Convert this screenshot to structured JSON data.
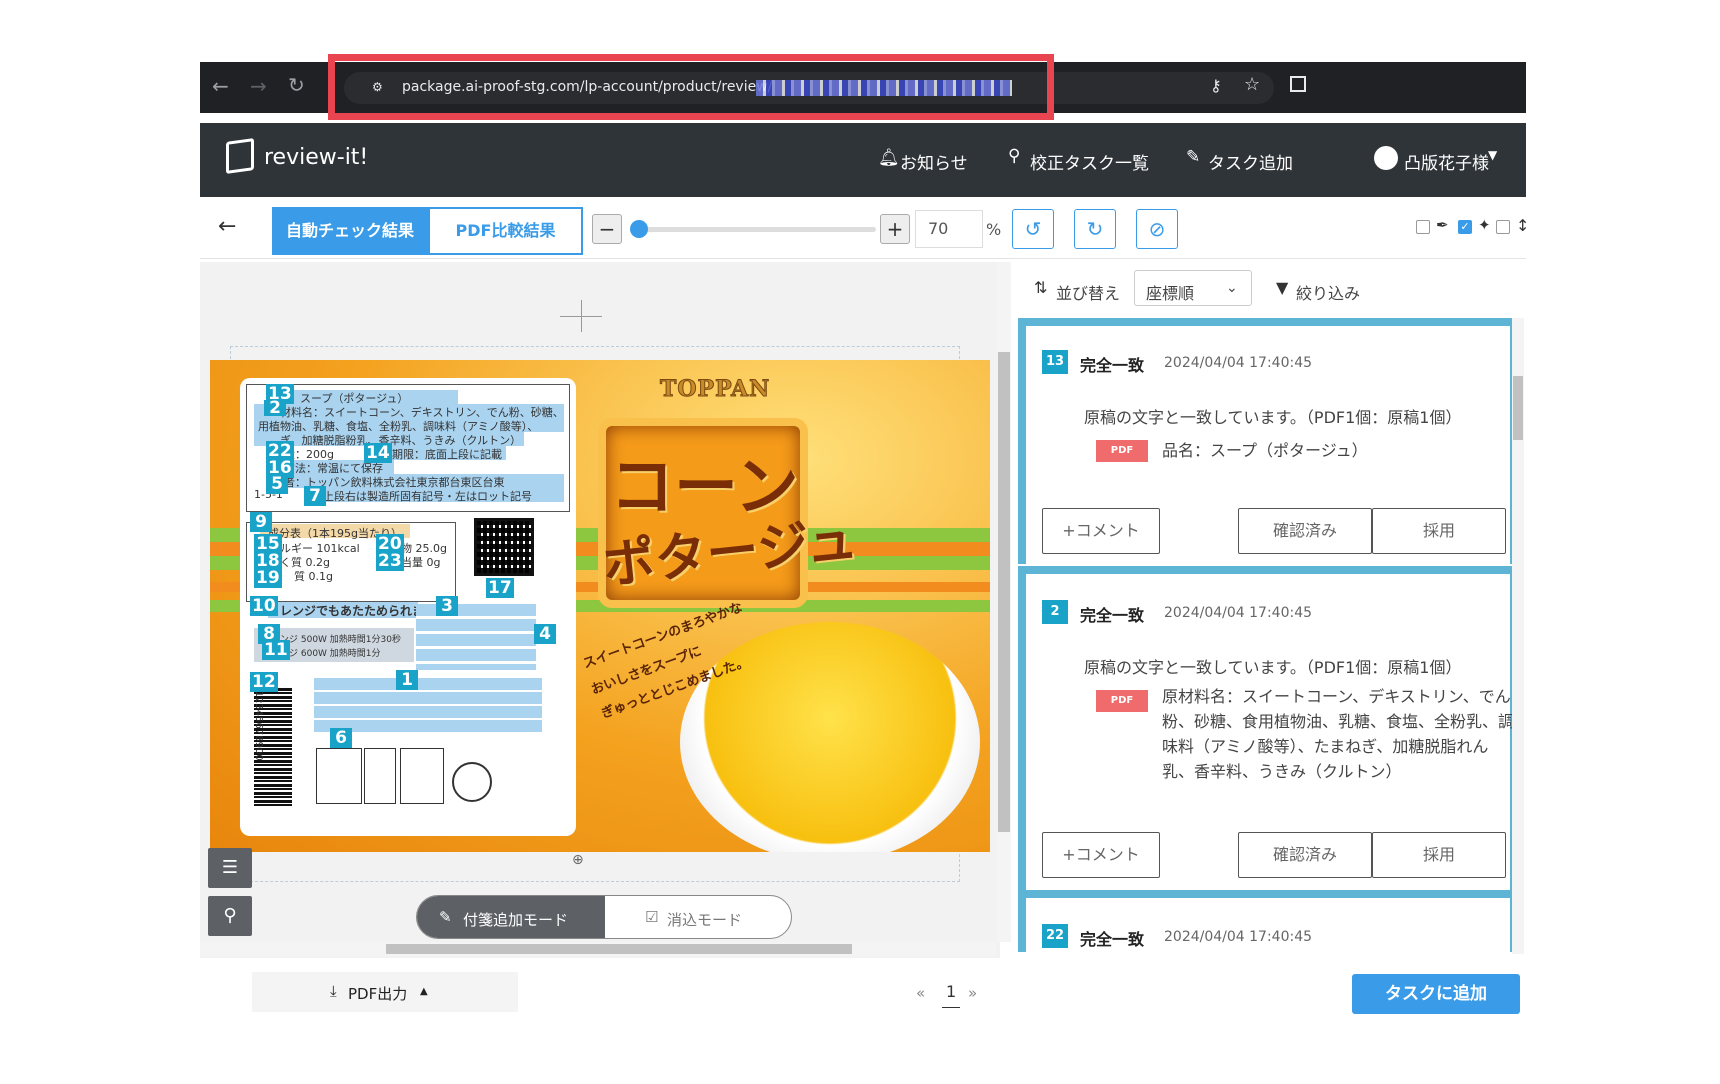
{
  "browser": {
    "url_visible": "package.ai-proof-stg.com/lp-account/product/review/",
    "back": "←",
    "forward": "→",
    "reload": "↻"
  },
  "app": {
    "brand": "review-it!",
    "nav": {
      "notifications": "お知らせ",
      "task_list": "校正タスク一覧",
      "add_task": "タスク追加",
      "user": "凸版花子様"
    }
  },
  "toolbar": {
    "back": "←",
    "tab_auto": "自動チェック結果",
    "tab_pdf": "PDF比較結果",
    "zoom_minus": "−",
    "zoom_plus": "+",
    "zoom": "70",
    "zoom_unit": "%",
    "zoom_level_pct": 0
  },
  "document": {
    "brand_logo": "TOPPAN",
    "title_line1": "コーン",
    "title_line2": "ポタージュ",
    "tagline1": "スイートコーンのまろやかな",
    "tagline2": "おいしさをスープに",
    "tagline3": "ぎゅっととじこめました。",
    "label_lines": [
      "名：スープ（ポタージュ）",
      "材料名：スイートコーン、デキストリン、でん粉、砂糖、",
      "用植物油、乳糖、食塩、全粉乳、調味料（アミノ酸等）、",
      "ぎ、加糖脱脂粉乳、香辛料、うきみ（クルトン）",
      "量：200g",
      "期限：底面上段に記載",
      "方法：常温にて保存",
      "者：トッパン飲料株式会社東京都台東区台東",
      "1-5-1",
      "面上段右は製造所固有記号・左はロット記号"
    ],
    "nutrition": [
      "成分表（1本195g当たり）",
      "ルギー 101kcal",
      "く質 0.2g",
      "質 0.1g",
      "化物 25.0g",
      "相当量 0g"
    ],
    "microwave_title": "レンジでもあたためられます。",
    "microwave_lines": [
      "ンジ 500W 加熱時間1分30秒",
      "ンジ 600W 加熱時間1分"
    ],
    "barcode": "4912345678900",
    "markers": [
      "13",
      "2",
      "22",
      "14",
      "16",
      "5",
      "7",
      "9",
      "15",
      "20",
      "18",
      "23",
      "19",
      "10",
      "3",
      "8",
      "4",
      "11",
      "17",
      "12",
      "1",
      "6"
    ],
    "bottom_tools": {
      "add_note": "付箋追加モード",
      "erase": "消込モード"
    }
  },
  "results": {
    "sort_label": "並び替え",
    "sort_value": "座標順",
    "filter": "絞り込み",
    "cards": [
      {
        "num": "13",
        "status": "完全一致",
        "time": "2024/04/04 17:40:45",
        "message": "原稿の文字と一致しています。（PDF1個：原稿1個）",
        "tag": "PDF",
        "text": "品名：スープ（ポタージュ）",
        "comment": "+コメント",
        "confirm": "確認済み",
        "adopt": "採用"
      },
      {
        "num": "2",
        "status": "完全一致",
        "time": "2024/04/04 17:40:45",
        "message": "原稿の文字と一致しています。（PDF1個：原稿1個）",
        "tag": "PDF",
        "text": "原材料名：スイートコーン、デキストリン、でん粉、砂糖、食用植物油、乳糖、食塩、全粉乳、調味料（アミノ酸等）、たまねぎ、加糖脱脂れん乳、香辛料、うきみ（クルトン）",
        "comment": "+コメント",
        "confirm": "確認済み",
        "adopt": "採用"
      },
      {
        "num": "22",
        "status": "完全一致",
        "time": "2024/04/04 17:40:45"
      }
    ]
  },
  "footer": {
    "pdf_export": "PDF出力",
    "page_prev": "«",
    "page": "1",
    "page_next": "»",
    "add_task": "タスクに追加"
  }
}
